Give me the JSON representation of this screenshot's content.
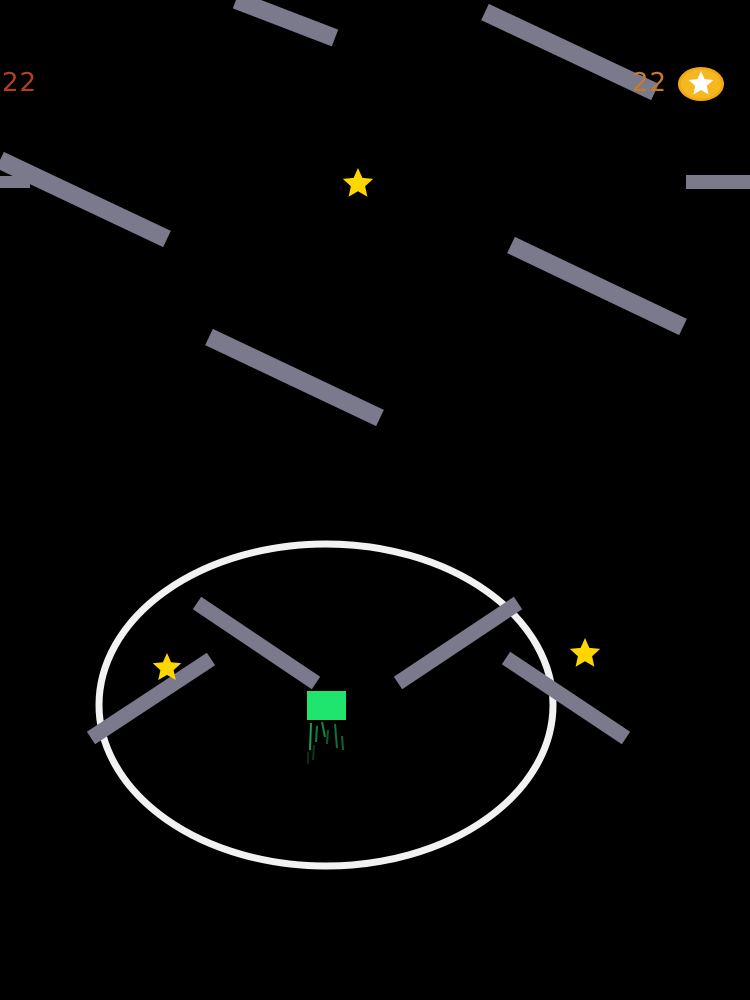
{
  "hud": {
    "score": "22",
    "coins": "22",
    "coin_icon": "star-coin-icon"
  },
  "colors": {
    "background": "#000000",
    "platform": "#7a7a8c",
    "ring": "#f2f2f2",
    "star": "#ffd700",
    "player": "#1fe46e",
    "score_text": "#b5401c",
    "coin_text": "#c8792a",
    "coin_fill": "#f0a818"
  },
  "scene": {
    "platform_count": 11,
    "star_count": 3,
    "player": "green-square",
    "ring": "white-circle"
  }
}
